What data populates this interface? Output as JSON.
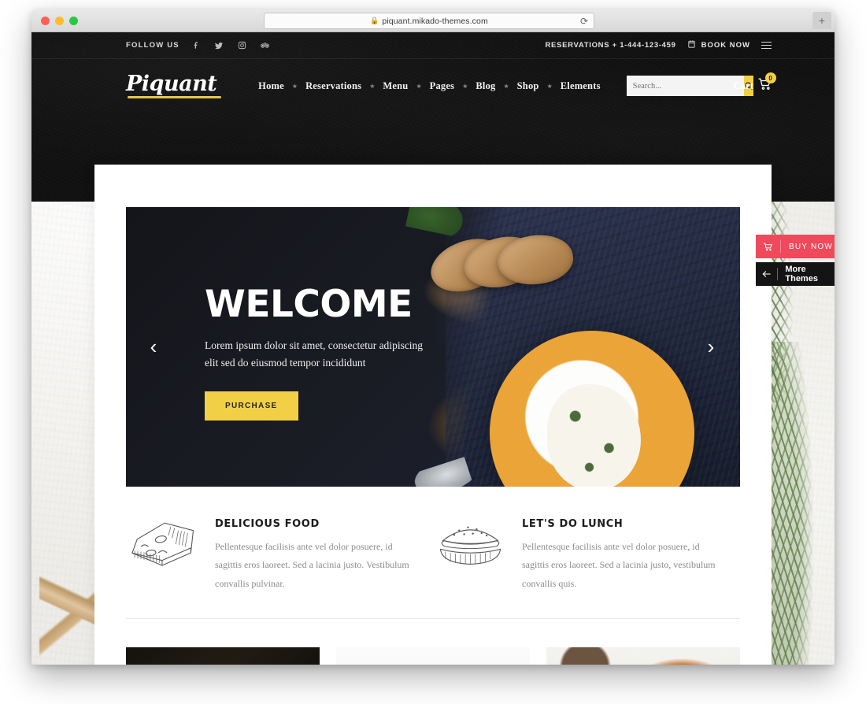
{
  "browser": {
    "url": "piquant.mikado-themes.com",
    "lock_icon": "lock-icon",
    "reload_icon": "reload-icon",
    "new_tab_label": "+"
  },
  "topbar": {
    "follow_label": "FOLLOW US",
    "social": [
      {
        "name": "facebook-icon",
        "label": "f"
      },
      {
        "name": "twitter-icon",
        "label": ""
      },
      {
        "name": "instagram-icon",
        "label": ""
      },
      {
        "name": "tripadvisor-icon",
        "label": ""
      }
    ],
    "reservations": "RESERVATIONS + 1-444-123-459",
    "book_now": "BOOK NOW",
    "calendar_icon": "calendar-icon",
    "menu_icon": "hamburger-icon"
  },
  "header": {
    "logo": "Piquant",
    "nav": [
      "Home",
      "Reservations",
      "Menu",
      "Pages",
      "Blog",
      "Shop",
      "Elements"
    ],
    "separator": "★",
    "search_placeholder": "Search...",
    "search_value": "",
    "search_icon": "search-icon",
    "cart_label": "Cart",
    "cart_count": "0",
    "cart_icon": "shopping-cart-icon"
  },
  "slider": {
    "title": "WELCOME",
    "text": "Lorem ipsum dolor sit amet, consectetur adipiscing elit sed do eiusmod tempor incididunt",
    "button": "PURCHASE",
    "prev_icon": "chevron-left-icon",
    "next_icon": "chevron-right-icon"
  },
  "features": [
    {
      "icon": "cheese-wedge-icon",
      "title": "DELICIOUS FOOD",
      "text": "Pellentesque facilisis ante vel dolor posuere, id sagittis eros laoreet. Sed a lacinia justo. Vestibulum convallis pulvinar."
    },
    {
      "icon": "hamburger-food-icon",
      "title": "LET'S DO LUNCH",
      "text": "Pellentesque facilisis ante vel dolor posuere, id sagittis eros laoreet. Sed a lacinia justo, vestibulum convallis quis."
    }
  ],
  "gallery": [
    {
      "name": "gallery-image-drink"
    },
    {
      "name": "gallery-image-bread"
    },
    {
      "name": "gallery-image-roast"
    }
  ],
  "cta": {
    "buy_now": "BUY NOW",
    "buy_icon": "cart-icon",
    "more_themes": "More Themes",
    "back_icon": "arrow-left-icon"
  },
  "colors": {
    "accent_yellow": "#F2D045",
    "buy_now_red": "#F0495C",
    "header_dark": "#101010"
  }
}
